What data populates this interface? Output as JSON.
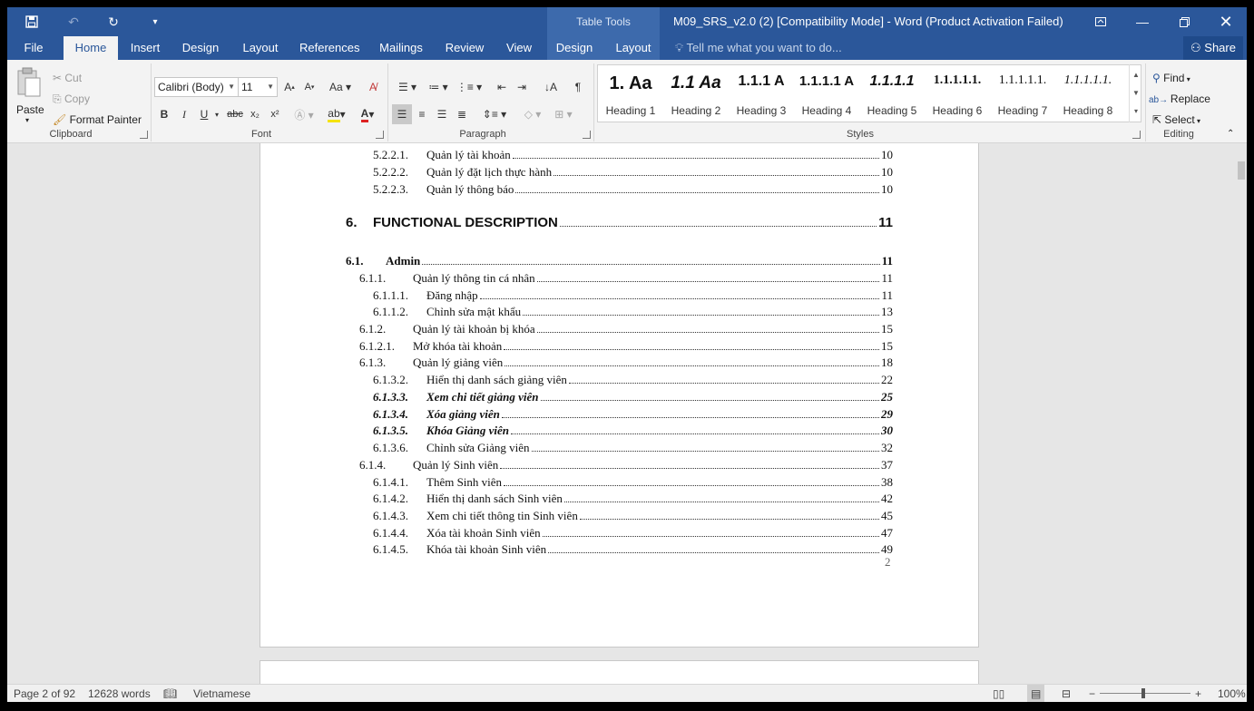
{
  "titlebar": {
    "context_tab_group": "Table Tools",
    "document_title": "M09_SRS_v2.0 (2) [Compatibility Mode] - Word (Product Activation Failed)"
  },
  "tabs": [
    "File",
    "Home",
    "Insert",
    "Design",
    "Layout",
    "References",
    "Mailings",
    "Review",
    "View",
    "Design",
    "Layout"
  ],
  "tell_me_placeholder": "Tell me what you want to do...",
  "share_label": "Share",
  "ribbon": {
    "clipboard": {
      "paste": "Paste",
      "cut": "Cut",
      "copy": "Copy",
      "format_painter": "Format Painter",
      "label": "Clipboard"
    },
    "font": {
      "family": "Calibri (Body)",
      "size": "11",
      "label": "Font"
    },
    "paragraph": {
      "label": "Paragraph"
    },
    "styles": {
      "label": "Styles",
      "items": [
        {
          "sample": "1.  Aa",
          "name": "Heading 1"
        },
        {
          "sample": "1.1  Aa",
          "name": "Heading 2"
        },
        {
          "sample": "1.1.1  A",
          "name": "Heading 3"
        },
        {
          "sample": "1.1.1.1  A",
          "name": "Heading 4"
        },
        {
          "sample": "1.1.1.1",
          "name": "Heading 5"
        },
        {
          "sample": "1.1.1.1.1.",
          "name": "Heading 6"
        },
        {
          "sample": "1.1.1.1.1.",
          "name": "Heading 7"
        },
        {
          "sample": "1.1.1.1.1.",
          "name": "Heading 8"
        }
      ]
    },
    "editing": {
      "find": "Find",
      "replace": "Replace",
      "select": "Select",
      "label": "Editing"
    }
  },
  "toc": [
    {
      "num": "5.2.2.1.",
      "text": "Quản lý tài khoản",
      "page": "10",
      "level": 3,
      "style": "normal"
    },
    {
      "num": "5.2.2.2.",
      "text": "Quản lý đặt lịch thực hành",
      "page": "10",
      "level": 3,
      "style": "normal"
    },
    {
      "num": "5.2.2.3.",
      "text": "Quản lý thông báo",
      "page": "10",
      "level": 3,
      "style": "normal"
    },
    {
      "num": "6.",
      "text": "FUNCTIONAL DESCRIPTION",
      "page": "11",
      "level": 0,
      "style": "big"
    },
    {
      "num": "6.1.",
      "text": "Admin",
      "page": "11",
      "level": 1,
      "style": "bold"
    },
    {
      "num": "6.1.1.",
      "text": "Quản lý thông tin cá nhân",
      "page": "11",
      "level": 2,
      "style": "normal"
    },
    {
      "num": "6.1.1.1.",
      "text": "Đăng nhập",
      "page": "11",
      "level": 3,
      "style": "normal"
    },
    {
      "num": "6.1.1.2.",
      "text": "Chỉnh sửa mật khẩu",
      "page": "13",
      "level": 3,
      "style": "normal"
    },
    {
      "num": "6.1.2.",
      "text": "Quản lý tài khoản bị khóa",
      "page": "15",
      "level": 2,
      "style": "normal"
    },
    {
      "num": "6.1.2.1.",
      "text": "Mở khóa tài khoản",
      "page": "15",
      "level": 2,
      "style": "normal"
    },
    {
      "num": "6.1.3.",
      "text": "Quản lý giảng viên",
      "page": "18",
      "level": 2,
      "style": "normal"
    },
    {
      "num": "6.1.3.2.",
      "text": "Hiển thị danh sách giảng viên",
      "page": "22",
      "level": 3,
      "style": "normal"
    },
    {
      "num": "6.1.3.3.",
      "text": "Xem chi tiết giảng viên",
      "page": "25",
      "level": 3,
      "style": "bi"
    },
    {
      "num": "6.1.3.4.",
      "text": "Xóa giảng viên",
      "page": "29",
      "level": 3,
      "style": "bi"
    },
    {
      "num": "6.1.3.5.",
      "text": "Khóa Giảng viên",
      "page": "30",
      "level": 3,
      "style": "bi"
    },
    {
      "num": "6.1.3.6.",
      "text": "Chỉnh sửa Giảng viên",
      "page": "32",
      "level": 3,
      "style": "normal"
    },
    {
      "num": "6.1.4.",
      "text": "Quản lý Sinh viên",
      "page": "37",
      "level": 2,
      "style": "normal"
    },
    {
      "num": "6.1.4.1.",
      "text": "Thêm Sinh viên",
      "page": "38",
      "level": 3,
      "style": "normal"
    },
    {
      "num": "6.1.4.2.",
      "text": "Hiển thị danh sách Sinh viên",
      "page": "42",
      "level": 3,
      "style": "normal"
    },
    {
      "num": "6.1.4.3.",
      "text": "Xem chi tiết thông tin Sinh viên",
      "page": "45",
      "level": 3,
      "style": "normal"
    },
    {
      "num": "6.1.4.4.",
      "text": "Xóa tài khoản Sinh viên",
      "page": "47",
      "level": 3,
      "style": "normal"
    },
    {
      "num": "6.1.4.5.",
      "text": "Khóa tài khoản Sinh viên",
      "page": "49",
      "level": 3,
      "style": "normal"
    }
  ],
  "page_number": "2",
  "status": {
    "page": "Page 2 of 92",
    "words": "12628 words",
    "language": "Vietnamese",
    "zoom": "100%"
  },
  "colors": {
    "title_bar": "#2b579a",
    "accent": "#2b579a"
  }
}
